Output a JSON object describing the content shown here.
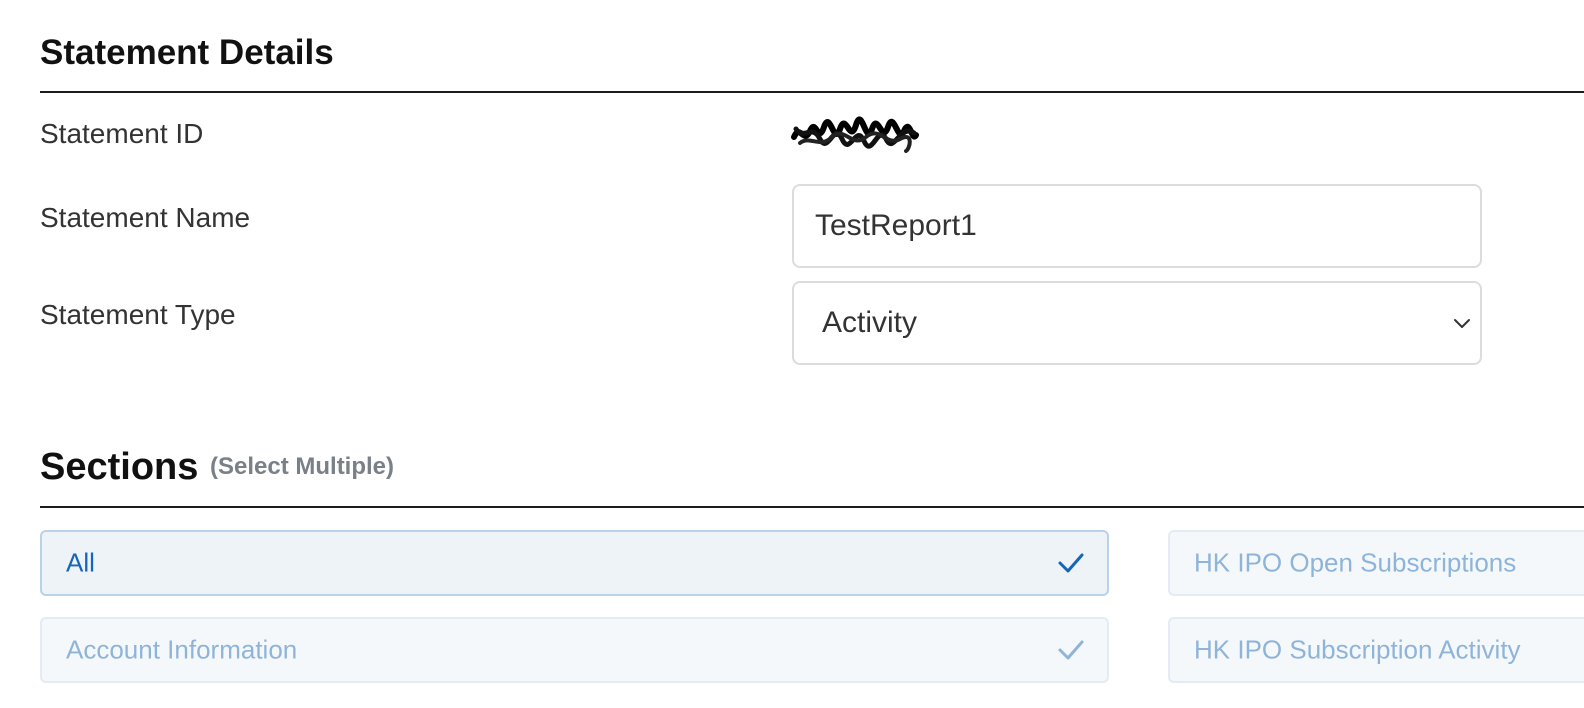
{
  "details": {
    "title": "Statement Details",
    "id_label": "Statement ID",
    "name_label": "Statement Name",
    "name_value": "TestReport1",
    "type_label": "Statement Type",
    "type_value": "Activity"
  },
  "sections": {
    "title": "Sections",
    "subtitle": "(Select Multiple)",
    "options": [
      {
        "label": "All",
        "selected": true,
        "checked": true
      },
      {
        "label": "HK IPO Open Subscriptions",
        "selected": false,
        "checked": false
      },
      {
        "label": "Account Information",
        "selected": false,
        "checked": true
      },
      {
        "label": "HK IPO Subscription Activity",
        "selected": false,
        "checked": false
      }
    ]
  },
  "icons": {
    "redaction": "scribble-redaction",
    "select_arrow": "chevron-down-icon",
    "check": "checkmark-icon"
  },
  "colors": {
    "selected_text": "#1565b8",
    "unselected_text": "#8fb4d9",
    "selected_border": "#b9d2e8",
    "option_background": "#f5f8fb",
    "rule": "#1c1c1c",
    "subtitle": "#7a8088"
  }
}
